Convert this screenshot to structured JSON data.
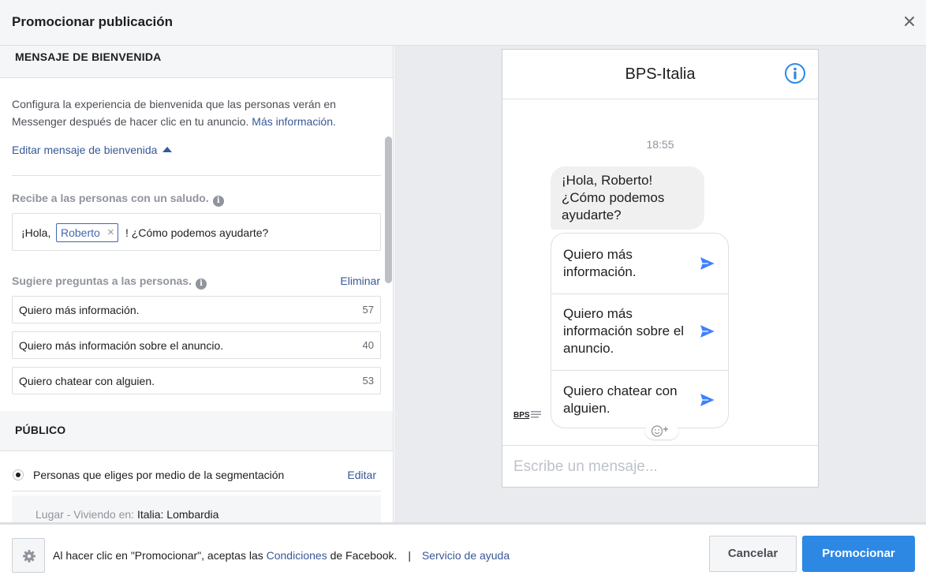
{
  "header": {
    "title": "Promocionar publicación"
  },
  "welcome": {
    "section_title": "MENSAJE DE BIENVENIDA",
    "description": "Configura la experiencia de bienvenida que las personas verán en Messenger después de hacer clic en tu anuncio.",
    "more_info": "Más información.",
    "edit_label": "Editar mensaje de bienvenida",
    "greeting_label": "Recibe a las personas con un saludo.",
    "greeting": {
      "before": "¡Hola,",
      "name_tag": "Roberto",
      "after": "! ¿Cómo podemos ayudarte?"
    },
    "questions_label": "Sugiere preguntas a las personas.",
    "delete_label": "Eliminar",
    "questions": [
      {
        "text": "Quiero más información.",
        "remaining": "57"
      },
      {
        "text": "Quiero más información sobre el anuncio.",
        "remaining": "40"
      },
      {
        "text": "Quiero chatear con alguien.",
        "remaining": "53"
      }
    ]
  },
  "audience": {
    "section_title": "PÚBLICO",
    "option_label": "Personas que eliges por medio de la segmentación",
    "edit_label": "Editar",
    "location_prefix": "Lugar - Viviendo en:",
    "location_value": "Italia: Lombardia"
  },
  "preview": {
    "page_name": "BPS-Italia",
    "time": "18:55",
    "greeting_bubble": "¡Hola, Roberto! ¿Cómo podemos ayudarte?",
    "replies": [
      "Quiero más información.",
      "Quiero más información sobre el anuncio.",
      "Quiero chatear con alguien."
    ],
    "compose_placeholder": "Escribe un mensaje...",
    "accent_color": "#4080ff"
  },
  "footer": {
    "legal_prefix": "Al hacer clic en \"Promocionar\", aceptas las",
    "terms_link": "Condiciones",
    "legal_suffix": "de Facebook.",
    "separator": "|",
    "help_link": "Servicio de ayuda",
    "cancel_label": "Cancelar",
    "promote_label": "Promocionar",
    "promote_color": "#2d88e4"
  }
}
